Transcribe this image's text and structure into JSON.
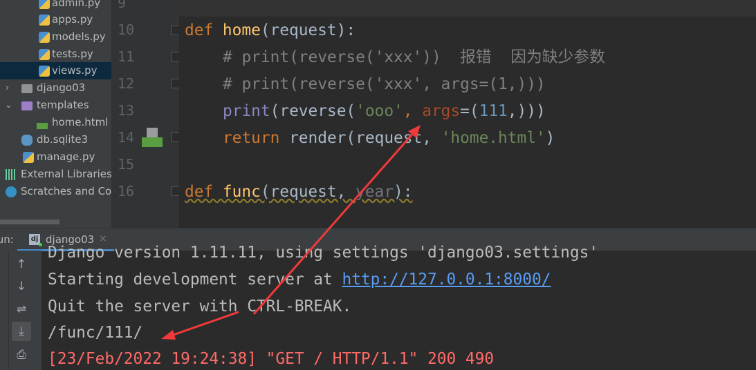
{
  "project_tree": [
    {
      "label": "admin.py",
      "icon": "python-file-icon"
    },
    {
      "label": "apps.py",
      "icon": "python-file-icon"
    },
    {
      "label": "models.py",
      "icon": "python-file-icon"
    },
    {
      "label": "tests.py",
      "icon": "python-file-icon"
    },
    {
      "label": "views.py",
      "icon": "python-file-icon",
      "selected": true
    },
    {
      "label": "django03",
      "icon": "folder-icon",
      "expanded": false
    },
    {
      "label": "templates",
      "icon": "folder-icon",
      "expanded": true
    },
    {
      "label": "home.html",
      "icon": "html-file-icon"
    },
    {
      "label": "db.sqlite3",
      "icon": "database-icon"
    },
    {
      "label": "manage.py",
      "icon": "python-file-icon"
    },
    {
      "label": "External Libraries",
      "icon": "libraries-icon"
    },
    {
      "label": "Scratches and Cor",
      "icon": "scratches-icon"
    }
  ],
  "editor": {
    "line_numbers": [
      "9",
      "10",
      "11",
      "12",
      "13",
      "14",
      "15",
      "16"
    ],
    "lines": {
      "l10": {
        "kw": "def ",
        "fn": "home",
        "rest": "(request):"
      },
      "l11": {
        "comment": "# print(reverse('xxx'))  报错  因为缺少参数"
      },
      "l12": {
        "comment": "# print(reverse('xxx', args=(1,)))"
      },
      "l13": {
        "print": "print",
        "a": "(reverse(",
        "str": "'ooo'",
        "comma": ", ",
        "param": "args",
        "b": "=(",
        "num": "111",
        "c": ",)))"
      },
      "l14": {
        "kw": "return ",
        "a": "render(request, ",
        "str": "'home.html'",
        "b": ")"
      },
      "l16": {
        "kw": "def ",
        "fn": "func",
        "a": "(request, ",
        "unused": "year",
        "b": "):"
      }
    }
  },
  "run_panel": {
    "label": "Run:",
    "tab": "django03",
    "close": "×",
    "icon_text": "dj",
    "console": {
      "line1": "Django version 1.11.11, using settings 'django03.settings'",
      "line2_prefix": "Starting development server at ",
      "line2_link": "http://127.0.0.1:8000/",
      "line3": "Quit the server with CTRL-BREAK.",
      "line4": "/func/111/",
      "line5": "[23/Feb/2022 19:24:38] \"GET / HTTP/1.1\" 200 490"
    }
  },
  "annotation_color": "#f03a3a"
}
